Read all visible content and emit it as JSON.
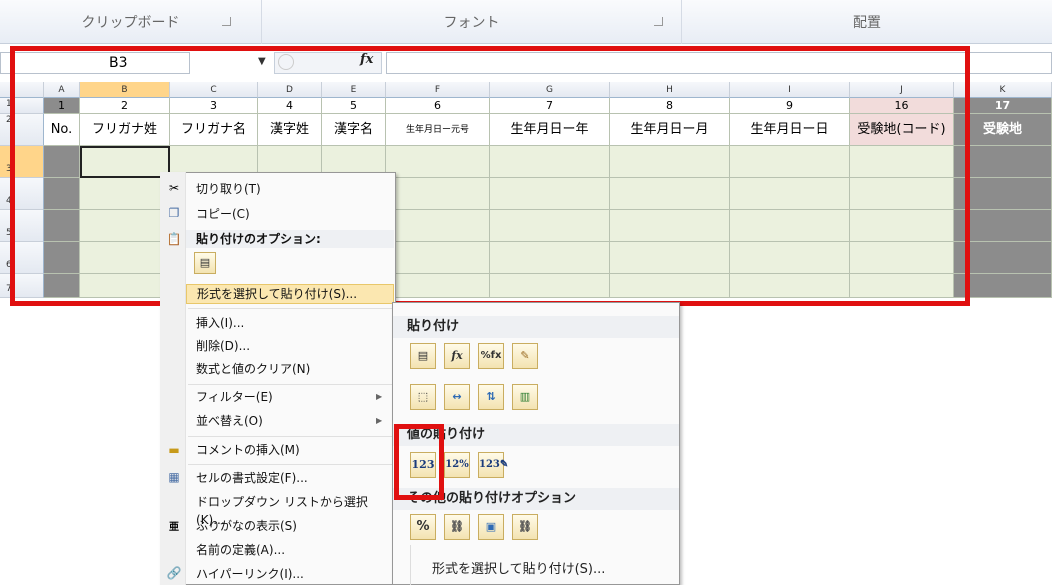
{
  "ribbon": {
    "groups": [
      "クリップボード",
      "フォント",
      "配置"
    ]
  },
  "formula_bar": {
    "name_box": "B3",
    "fx_label": "fx",
    "formula": ""
  },
  "columns": [
    "A",
    "B",
    "C",
    "D",
    "E",
    "F",
    "G",
    "H",
    "I",
    "J",
    "K"
  ],
  "row_numbers": [
    "1",
    "2",
    "3",
    "4",
    "5",
    "6",
    "7"
  ],
  "row1": [
    "1",
    "2",
    "3",
    "4",
    "5",
    "6",
    "7",
    "8",
    "9",
    "16",
    "17"
  ],
  "row2": [
    "No.",
    "フリガナ姓",
    "フリガナ名",
    "漢字姓",
    "漢字名",
    "生年月日ー元号",
    "生年月日ー年",
    "生年月日ー月",
    "生年月日ー日",
    "受験地(コード)",
    "受験地"
  ],
  "context_menu": {
    "items": {
      "cut": "切り取り(T)",
      "copy": "コピー(C)",
      "paste_options": "貼り付けのオプション:",
      "paste_special": "形式を選択して貼り付け(S)...",
      "insert": "挿入(I)...",
      "delete": "削除(D)...",
      "clear": "数式と値のクリア(N)",
      "filter": "フィルター(E)",
      "sort": "並べ替え(O)",
      "insert_comment": "コメントの挿入(M)",
      "format_cells": "セルの書式設定(F)...",
      "pick_dropdown": "ドロップダウン リストから選択(K)...",
      "phonetic": "ふりがなの表示(S)",
      "define_name": "名前の定義(A)...",
      "hyperlink": "ハイパーリンク(I)..."
    }
  },
  "paste_submenu": {
    "paste_header": "貼り付け",
    "values_header": "値の貼り付け",
    "other_header": "その他の貼り付けオプション",
    "values_icon_text": "123",
    "paste_special": "形式を選択して貼り付け(S)..."
  },
  "colors": {
    "highlight_red": "#e01010",
    "cell_green": "#ebf1de",
    "dark_gray": "#8c8c8c",
    "pink": "#f2dcdb"
  }
}
